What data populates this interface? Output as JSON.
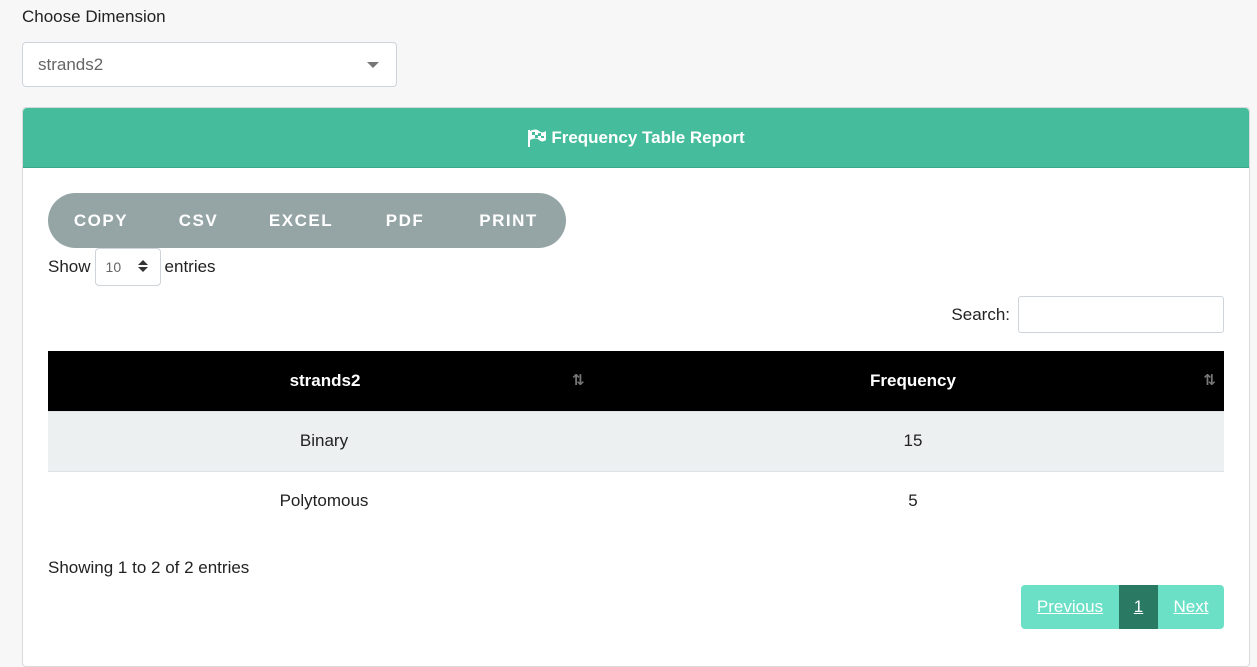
{
  "dimension": {
    "label": "Choose Dimension",
    "selected": "strands2"
  },
  "report": {
    "title": "Frequency Table Report",
    "icon": "flag-checkered-icon",
    "header_color": "#45bd9c"
  },
  "export_buttons": [
    "COPY",
    "CSV",
    "EXCEL",
    "PDF",
    "PRINT"
  ],
  "length": {
    "prefix": "Show",
    "value": "10",
    "suffix": "entries"
  },
  "search": {
    "label": "Search:",
    "value": ""
  },
  "table": {
    "headers": [
      "strands2",
      "Frequency"
    ],
    "rows": [
      [
        "Binary",
        "15"
      ],
      [
        "Polytomous",
        "5"
      ]
    ]
  },
  "info": "Showing 1 to 2 of 2 entries",
  "pagination": {
    "previous": "Previous",
    "current": "1",
    "next": "Next"
  }
}
